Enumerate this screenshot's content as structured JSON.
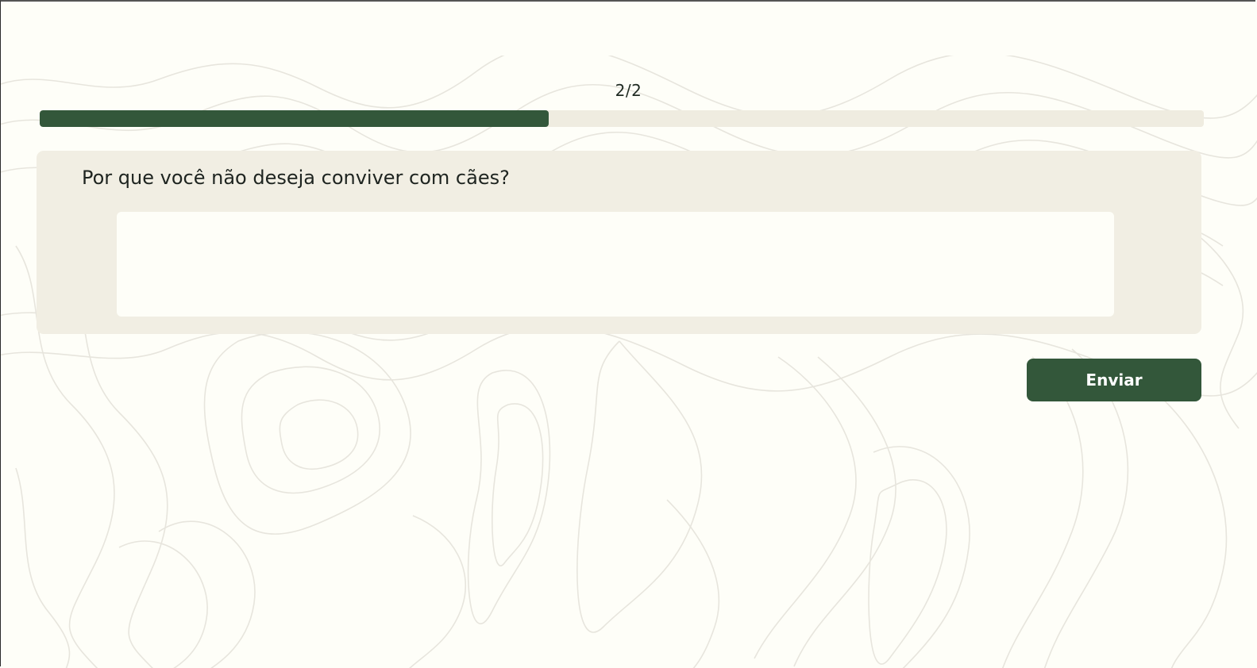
{
  "progress": {
    "counter": "2/2",
    "fraction": 0.437
  },
  "question": {
    "text": "Por que você não deseja conviver com cães?",
    "answer_value": "",
    "placeholder": ""
  },
  "actions": {
    "submit_label": "Enviar"
  },
  "colors": {
    "accent": "#33573a",
    "background": "#fefef8",
    "card": "#f1eee3",
    "track": "#efece0",
    "pattern_line": "#e6e4dc"
  }
}
